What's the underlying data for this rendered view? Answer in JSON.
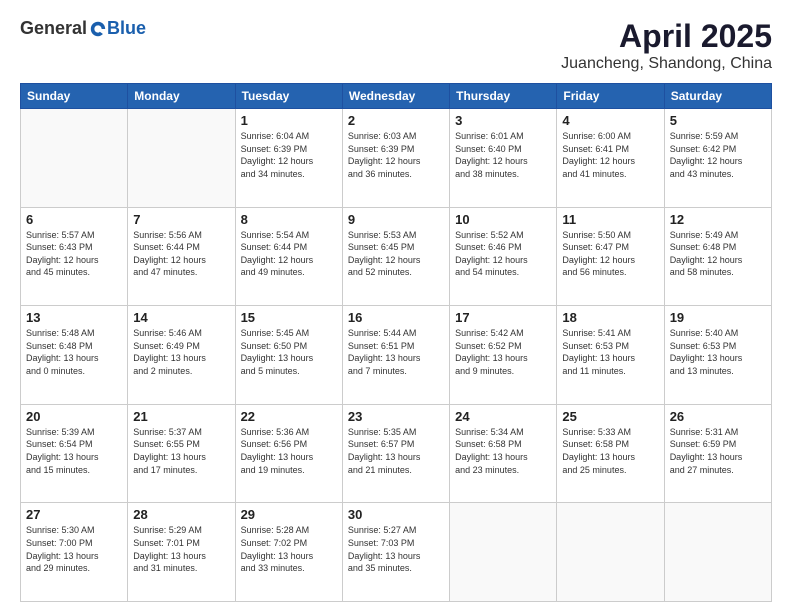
{
  "header": {
    "logo": {
      "general": "General",
      "blue": "Blue"
    },
    "title": "April 2025",
    "location": "Juancheng, Shandong, China"
  },
  "days_of_week": [
    "Sunday",
    "Monday",
    "Tuesday",
    "Wednesday",
    "Thursday",
    "Friday",
    "Saturday"
  ],
  "weeks": [
    [
      {
        "day": "",
        "info": ""
      },
      {
        "day": "",
        "info": ""
      },
      {
        "day": "1",
        "info": "Sunrise: 6:04 AM\nSunset: 6:39 PM\nDaylight: 12 hours\nand 34 minutes."
      },
      {
        "day": "2",
        "info": "Sunrise: 6:03 AM\nSunset: 6:39 PM\nDaylight: 12 hours\nand 36 minutes."
      },
      {
        "day": "3",
        "info": "Sunrise: 6:01 AM\nSunset: 6:40 PM\nDaylight: 12 hours\nand 38 minutes."
      },
      {
        "day": "4",
        "info": "Sunrise: 6:00 AM\nSunset: 6:41 PM\nDaylight: 12 hours\nand 41 minutes."
      },
      {
        "day": "5",
        "info": "Sunrise: 5:59 AM\nSunset: 6:42 PM\nDaylight: 12 hours\nand 43 minutes."
      }
    ],
    [
      {
        "day": "6",
        "info": "Sunrise: 5:57 AM\nSunset: 6:43 PM\nDaylight: 12 hours\nand 45 minutes."
      },
      {
        "day": "7",
        "info": "Sunrise: 5:56 AM\nSunset: 6:44 PM\nDaylight: 12 hours\nand 47 minutes."
      },
      {
        "day": "8",
        "info": "Sunrise: 5:54 AM\nSunset: 6:44 PM\nDaylight: 12 hours\nand 49 minutes."
      },
      {
        "day": "9",
        "info": "Sunrise: 5:53 AM\nSunset: 6:45 PM\nDaylight: 12 hours\nand 52 minutes."
      },
      {
        "day": "10",
        "info": "Sunrise: 5:52 AM\nSunset: 6:46 PM\nDaylight: 12 hours\nand 54 minutes."
      },
      {
        "day": "11",
        "info": "Sunrise: 5:50 AM\nSunset: 6:47 PM\nDaylight: 12 hours\nand 56 minutes."
      },
      {
        "day": "12",
        "info": "Sunrise: 5:49 AM\nSunset: 6:48 PM\nDaylight: 12 hours\nand 58 minutes."
      }
    ],
    [
      {
        "day": "13",
        "info": "Sunrise: 5:48 AM\nSunset: 6:48 PM\nDaylight: 13 hours\nand 0 minutes."
      },
      {
        "day": "14",
        "info": "Sunrise: 5:46 AM\nSunset: 6:49 PM\nDaylight: 13 hours\nand 2 minutes."
      },
      {
        "day": "15",
        "info": "Sunrise: 5:45 AM\nSunset: 6:50 PM\nDaylight: 13 hours\nand 5 minutes."
      },
      {
        "day": "16",
        "info": "Sunrise: 5:44 AM\nSunset: 6:51 PM\nDaylight: 13 hours\nand 7 minutes."
      },
      {
        "day": "17",
        "info": "Sunrise: 5:42 AM\nSunset: 6:52 PM\nDaylight: 13 hours\nand 9 minutes."
      },
      {
        "day": "18",
        "info": "Sunrise: 5:41 AM\nSunset: 6:53 PM\nDaylight: 13 hours\nand 11 minutes."
      },
      {
        "day": "19",
        "info": "Sunrise: 5:40 AM\nSunset: 6:53 PM\nDaylight: 13 hours\nand 13 minutes."
      }
    ],
    [
      {
        "day": "20",
        "info": "Sunrise: 5:39 AM\nSunset: 6:54 PM\nDaylight: 13 hours\nand 15 minutes."
      },
      {
        "day": "21",
        "info": "Sunrise: 5:37 AM\nSunset: 6:55 PM\nDaylight: 13 hours\nand 17 minutes."
      },
      {
        "day": "22",
        "info": "Sunrise: 5:36 AM\nSunset: 6:56 PM\nDaylight: 13 hours\nand 19 minutes."
      },
      {
        "day": "23",
        "info": "Sunrise: 5:35 AM\nSunset: 6:57 PM\nDaylight: 13 hours\nand 21 minutes."
      },
      {
        "day": "24",
        "info": "Sunrise: 5:34 AM\nSunset: 6:58 PM\nDaylight: 13 hours\nand 23 minutes."
      },
      {
        "day": "25",
        "info": "Sunrise: 5:33 AM\nSunset: 6:58 PM\nDaylight: 13 hours\nand 25 minutes."
      },
      {
        "day": "26",
        "info": "Sunrise: 5:31 AM\nSunset: 6:59 PM\nDaylight: 13 hours\nand 27 minutes."
      }
    ],
    [
      {
        "day": "27",
        "info": "Sunrise: 5:30 AM\nSunset: 7:00 PM\nDaylight: 13 hours\nand 29 minutes."
      },
      {
        "day": "28",
        "info": "Sunrise: 5:29 AM\nSunset: 7:01 PM\nDaylight: 13 hours\nand 31 minutes."
      },
      {
        "day": "29",
        "info": "Sunrise: 5:28 AM\nSunset: 7:02 PM\nDaylight: 13 hours\nand 33 minutes."
      },
      {
        "day": "30",
        "info": "Sunrise: 5:27 AM\nSunset: 7:03 PM\nDaylight: 13 hours\nand 35 minutes."
      },
      {
        "day": "",
        "info": ""
      },
      {
        "day": "",
        "info": ""
      },
      {
        "day": "",
        "info": ""
      }
    ]
  ]
}
